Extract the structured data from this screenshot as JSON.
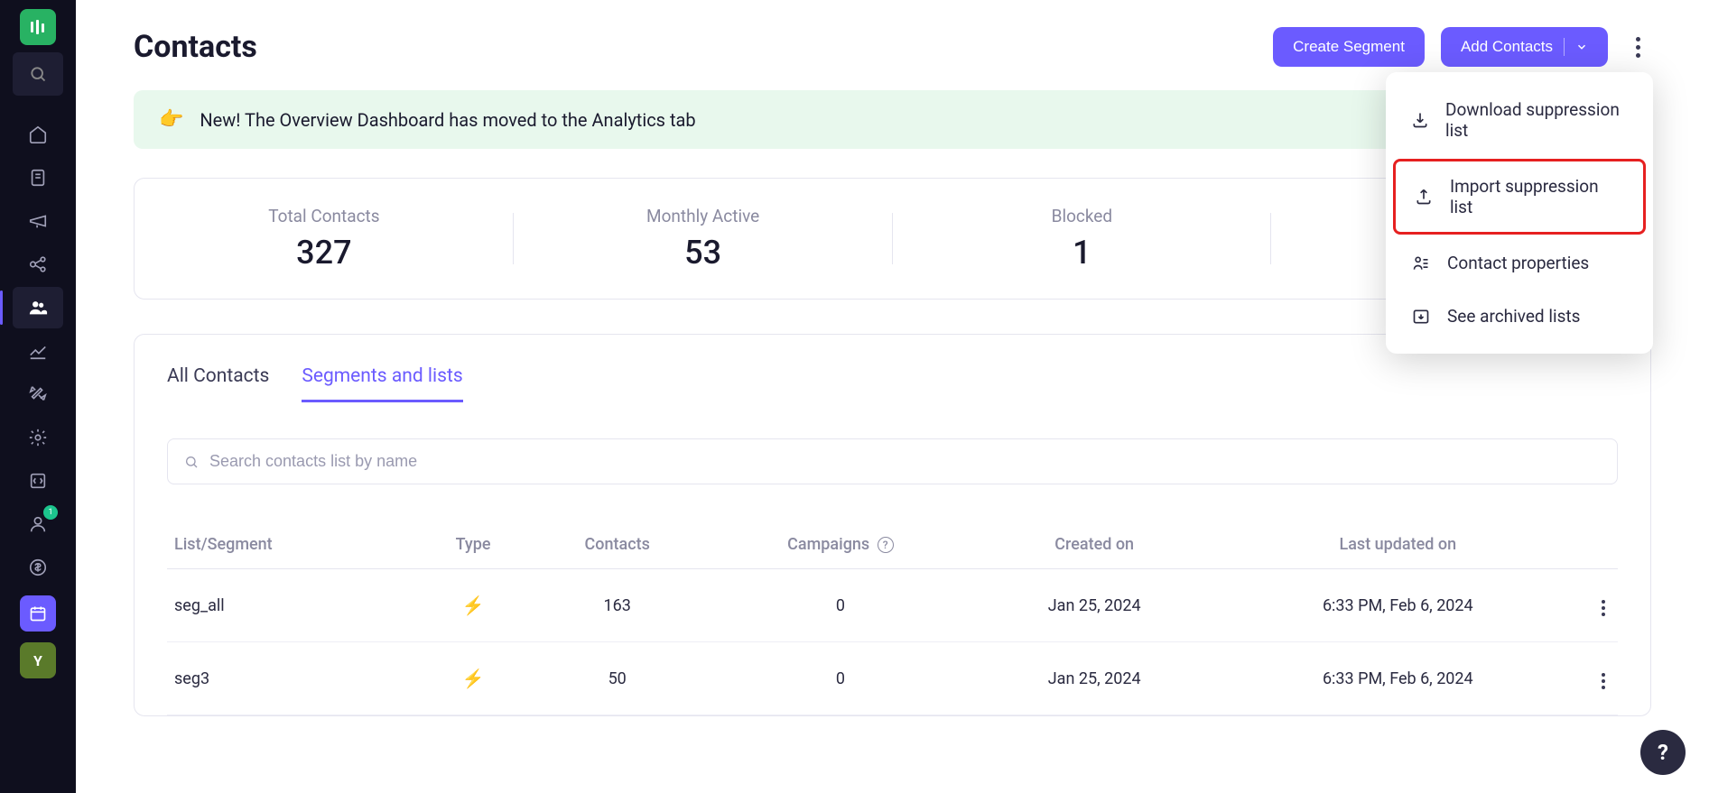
{
  "page": {
    "title": "Contacts"
  },
  "header": {
    "create_segment": "Create Segment",
    "add_contacts": "Add Contacts"
  },
  "banner": {
    "text": "New! The Overview Dashboard has moved to the Analytics tab"
  },
  "stats": {
    "total_label": "Total Contacts",
    "total_value": "327",
    "monthly_label": "Monthly Active",
    "monthly_value": "53",
    "blocked_label": "Blocked",
    "blocked_value": "1"
  },
  "tabs": {
    "all": "All Contacts",
    "segments": "Segments and lists"
  },
  "search": {
    "placeholder": "Search contacts list by name"
  },
  "table": {
    "headers": {
      "name": "List/Segment",
      "type": "Type",
      "contacts": "Contacts",
      "campaigns": "Campaigns",
      "created": "Created on",
      "updated": "Last updated on"
    },
    "rows": [
      {
        "name": "seg_all",
        "contacts": "163",
        "campaigns": "0",
        "created": "Jan 25, 2024",
        "updated": "6:33 PM, Feb 6, 2024"
      },
      {
        "name": "seg3",
        "contacts": "50",
        "campaigns": "0",
        "created": "Jan 25, 2024",
        "updated": "6:33 PM, Feb 6, 2024"
      }
    ]
  },
  "dropdown": {
    "download": "Download suppression list",
    "import": "Import suppression list",
    "properties": "Contact properties",
    "archived": "See archived lists"
  },
  "sidebar": {
    "letter": "Y",
    "badge": "1"
  }
}
